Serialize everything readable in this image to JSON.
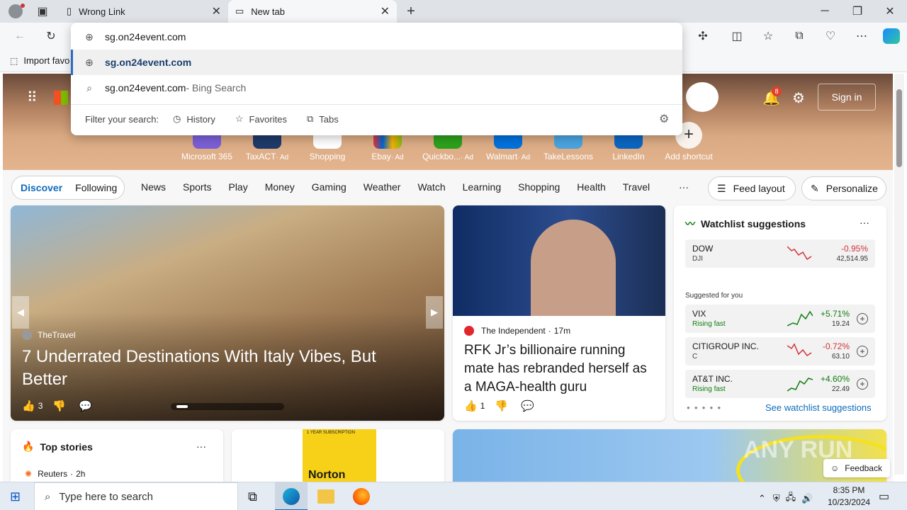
{
  "tabs": [
    {
      "title": "Wrong Link"
    },
    {
      "title": "New tab"
    }
  ],
  "window_controls": {
    "minimize": "─",
    "maximize": "❐",
    "close": "✕"
  },
  "address": {
    "value": "sg.on24event.com"
  },
  "favorites_bar": {
    "import_label": "Import favo"
  },
  "dropdown": {
    "suggestions": [
      {
        "text": "sg.on24event.com",
        "suffix": ""
      },
      {
        "text": "sg.on24event.com",
        "suffix": " - Bing Search"
      }
    ],
    "filter_label": "Filter your search:",
    "filters": [
      "History",
      "Favorites",
      "Tabs"
    ]
  },
  "header": {
    "notification_count": "8",
    "sign_in": "Sign in"
  },
  "shortcuts": [
    {
      "label": "Microsoft 365",
      "ad": ""
    },
    {
      "label": "TaxACT",
      "ad": "· Ad"
    },
    {
      "label": "Shopping",
      "ad": ""
    },
    {
      "label": "Ebay",
      "ad": "· Ad"
    },
    {
      "label": "Quickbo...",
      "ad": "· Ad"
    },
    {
      "label": "Walmart",
      "ad": "· Ad"
    },
    {
      "label": "TakeLessons",
      "ad": ""
    },
    {
      "label": "LinkedIn",
      "ad": ""
    },
    {
      "label": "Add shortcut",
      "ad": ""
    }
  ],
  "feed_nav": {
    "toggle": [
      "Discover",
      "Following"
    ],
    "items": [
      "News",
      "Sports",
      "Play",
      "Money",
      "Gaming",
      "Weather",
      "Watch",
      "Learning",
      "Shopping",
      "Health",
      "Travel"
    ],
    "more": "···",
    "feed_layout": "Feed layout",
    "personalize": "Personalize"
  },
  "main_story": {
    "source": "TheTravel",
    "title": "7 Underrated Destinations With Italy Vibes, But Better",
    "likes": "3"
  },
  "second_story": {
    "source": "The Independent",
    "time": "17m",
    "title": "RFK Jr’s billionaire running mate has rebranded herself as a MAGA-health guru",
    "likes": "1"
  },
  "watchlist": {
    "title": "Watchlist suggestions",
    "more": "···",
    "top": {
      "name": "DOW",
      "sub": "DJI",
      "pct": "-0.95%",
      "value": "42,514.95"
    },
    "suggested_label": "Suggested for you",
    "items": [
      {
        "name": "VIX",
        "sub": "Rising fast",
        "pct": "+5.71%",
        "value": "19.24",
        "up": true
      },
      {
        "name": "CITIGROUP INC.",
        "sub": "C",
        "pct": "-0.72%",
        "value": "63.10",
        "up": false
      },
      {
        "name": "AT&T INC.",
        "sub": "Rising fast",
        "pct": "+4.60%",
        "value": "22.49",
        "up": true
      }
    ],
    "see_more": "See watchlist suggestions"
  },
  "top_stories": {
    "title": "Top stories",
    "more": "···",
    "first_source": "Reuters",
    "first_time": "2h"
  },
  "ad_card": {
    "product": "Norton",
    "badge": "1 YEAR SUBSCRIPTION"
  },
  "feedback": "Feedback",
  "watermark": "ANY RUN",
  "taskbar": {
    "search_placeholder": "Type here to search",
    "time": "8:35 PM",
    "date": "10/23/2024"
  },
  "colors": {
    "accent": "#0f6cbd",
    "up": "#107c10",
    "down": "#d13438"
  }
}
